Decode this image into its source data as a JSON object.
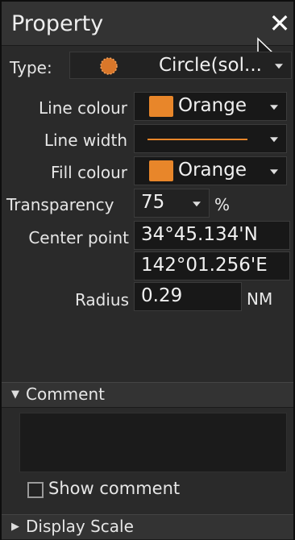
{
  "window": {
    "title": "Property"
  },
  "type_row": {
    "label": "Type:",
    "value": "Circle(sol...",
    "icon": "circle-solid-icon"
  },
  "line_colour": {
    "label": "Line colour",
    "value": "Orange",
    "color": "#e8862a"
  },
  "line_width": {
    "label": "Line width"
  },
  "fill_colour": {
    "label": "Fill colour",
    "value": "Orange",
    "color": "#e8862a"
  },
  "transparency": {
    "label": "Transparency",
    "value": "75",
    "unit": "%"
  },
  "center_point": {
    "label": "Center point",
    "lat": "34°45.134'N",
    "lon": "142°01.256'E"
  },
  "radius": {
    "label": "Radius",
    "value": "0.29",
    "unit": "NM"
  },
  "comment": {
    "header": "Comment",
    "show_label": "Show comment",
    "show_checked": false
  },
  "display_scale": {
    "header": "Display Scale"
  }
}
